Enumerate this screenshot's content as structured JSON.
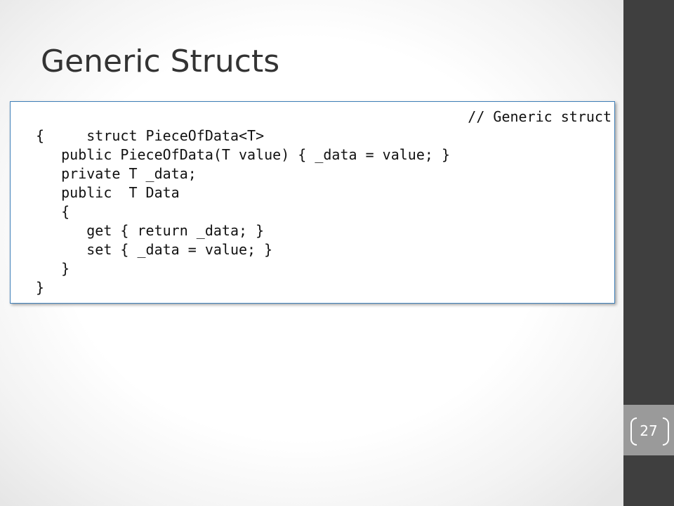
{
  "slide": {
    "title": "Generic Structs",
    "page_number": "27"
  },
  "code": {
    "comment": "// Generic struct",
    "lines": [
      "struct PieceOfData<T>",
      "{",
      "   public PieceOfData(T value) { _data = value; }",
      "   private T _data;",
      "   public  T Data",
      "   {",
      "      get { return _data; }",
      "      set { _data = value; }",
      "   }",
      "}"
    ]
  },
  "colors": {
    "sidebar": "#3f3f3f",
    "page_box": "#9a9a9a",
    "panel_border": "#3f7fb8",
    "title_text": "#333333"
  }
}
